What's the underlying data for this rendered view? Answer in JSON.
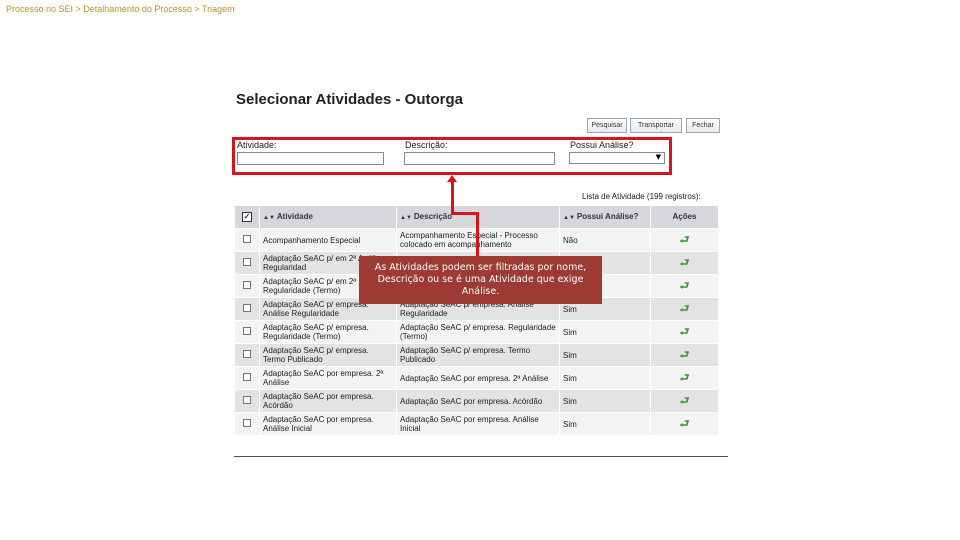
{
  "breadcrumb": "Processo no SEI > Detalhamento do Processo > Triagem",
  "page_title": "Selecionar Atividades - Outorga",
  "toolbar": {
    "search": "Pesquisar",
    "transport": "Transportar",
    "close": "Fechar"
  },
  "filters": {
    "activity_label": "Atividade:",
    "activity_value": "",
    "description_label": "Descrição:",
    "description_value": "",
    "analysis_label": "Possui Análise?",
    "analysis_value": ""
  },
  "list_caption": "Lista de Atividade (199 registros):",
  "table": {
    "headers": {
      "activity": "Atividade",
      "description": "Descrição",
      "analysis": "Possui Análise?",
      "actions": "Ações"
    },
    "rows": [
      {
        "activity": "Acompanhamento Especial",
        "description": "Acompanhamento Especial - Processo colocado em acompanhamento",
        "analysis": "Não"
      },
      {
        "activity": "Adaptação SeAC p/ em 2ª Análise Regularidad",
        "description": "",
        "analysis": ""
      },
      {
        "activity": "Adaptação SeAC p/ em 2ª Regularidade (Termo)",
        "description": "",
        "analysis": ""
      },
      {
        "activity": "Adaptação SeAC p/ empresa. Análise Regularidade",
        "description": "Adaptação SeAC p/ empresa. Análise Regularidade",
        "analysis": "Sim"
      },
      {
        "activity": "Adaptação SeAC p/ empresa. Regularidade (Termo)",
        "description": "Adaptação SeAC p/ empresa. Regularidade (Termo)",
        "analysis": "Sim"
      },
      {
        "activity": "Adaptação SeAC p/ empresa. Termo Publicado",
        "description": "Adaptação SeAC p/ empresa. Termo Publicado",
        "analysis": "Sim"
      },
      {
        "activity": "Adaptação SeAC por empresa. 2ª Análise",
        "description": "Adaptação SeAC por empresa. 2ª Análise",
        "analysis": "Sim"
      },
      {
        "activity": "Adaptação SeAC por empresa. Acórdão",
        "description": "Adaptação SeAC por empresa. Acórdão",
        "analysis": "Sim"
      },
      {
        "activity": "Adaptação SeAC por empresa. Análise Inicial",
        "description": "Adaptação SeAC por empresa. Análise Inicial",
        "analysis": "Sim"
      }
    ]
  },
  "callout": "As Atividades podem ser filtradas por nome, Descrição ou se é uma Atividade que exige Análise.",
  "icons": {
    "select_all": "checkbox-checked-icon",
    "row_action": "select-arrow-icon"
  },
  "colors": {
    "highlight_border": "#d9131b",
    "callout_bg": "#9e3a34",
    "breadcrumb_text": "#c0902a",
    "action_icon": "#3a9a3a"
  }
}
